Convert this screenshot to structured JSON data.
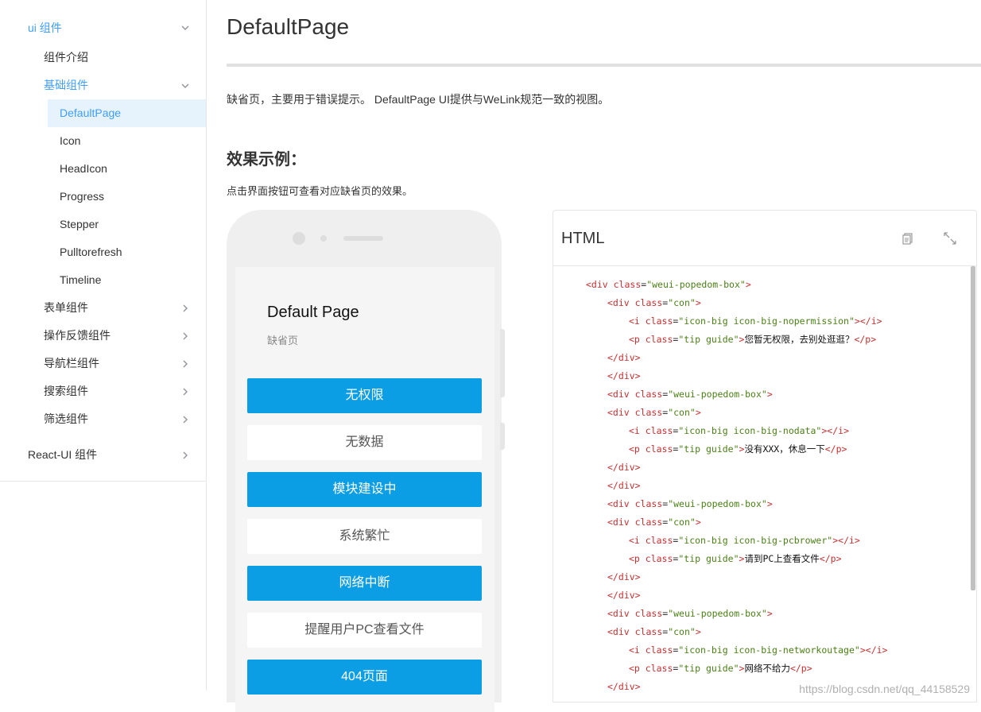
{
  "sidebar": {
    "ui_group": "ui 组件",
    "intro": "组件介绍",
    "basic_group": "基础组件",
    "basic_items": [
      "DefaultPage",
      "Icon",
      "HeadIcon",
      "Progress",
      "Stepper",
      "Pulltorefresh",
      "Timeline"
    ],
    "other_groups": [
      "表单组件",
      "操作反馈组件",
      "导航栏组件",
      "搜索组件",
      "筛选组件"
    ],
    "react_group": "React-UI 组件"
  },
  "main": {
    "title": "DefaultPage",
    "description": "缺省页，主要用于错误提示。 DefaultPage UI提供与WeLink规范一致的视图。",
    "section_title": "效果示例：",
    "hint": "点击界面按钮可查看对应缺省页的效果。"
  },
  "phone": {
    "title": "Default Page",
    "subtitle": "缺省页",
    "buttons": [
      "无权限",
      "无数据",
      "模块建设中",
      "系统繁忙",
      "网络中断",
      "提醒用户PC查看文件",
      "404页面"
    ]
  },
  "code": {
    "lang": "HTML",
    "lines": [
      {
        "indent": 0,
        "kind": "open",
        "tag": "div",
        "class": "weui-popedom-box",
        "text": ""
      },
      {
        "indent": 1,
        "kind": "open",
        "tag": "div",
        "class": "con",
        "text": ""
      },
      {
        "indent": 2,
        "kind": "pair",
        "tag": "i",
        "class": "icon-big icon-big-nopermission",
        "text": ""
      },
      {
        "indent": 2,
        "kind": "pair",
        "tag": "p",
        "class": "tip guide",
        "text": "您暂无权限，去别处逛逛？"
      },
      {
        "indent": 1,
        "kind": "close",
        "tag": "div",
        "class": "",
        "text": ""
      },
      {
        "indent": 1,
        "kind": "close",
        "tag": "div",
        "class": "",
        "text": ""
      },
      {
        "indent": 1,
        "kind": "open",
        "tag": "div",
        "class": "weui-popedom-box",
        "text": ""
      },
      {
        "indent": 1,
        "kind": "open",
        "tag": "div",
        "class": "con",
        "text": ""
      },
      {
        "indent": 2,
        "kind": "pair",
        "tag": "i",
        "class": "icon-big icon-big-nodata",
        "text": ""
      },
      {
        "indent": 2,
        "kind": "pair",
        "tag": "p",
        "class": "tip guide",
        "text": "没有XXX，休息一下"
      },
      {
        "indent": 1,
        "kind": "close",
        "tag": "div",
        "class": "",
        "text": ""
      },
      {
        "indent": 1,
        "kind": "close",
        "tag": "div",
        "class": "",
        "text": ""
      },
      {
        "indent": 1,
        "kind": "open",
        "tag": "div",
        "class": "weui-popedom-box",
        "text": ""
      },
      {
        "indent": 1,
        "kind": "open",
        "tag": "div",
        "class": "con",
        "text": ""
      },
      {
        "indent": 2,
        "kind": "pair",
        "tag": "i",
        "class": "icon-big icon-big-pcbrower",
        "text": ""
      },
      {
        "indent": 2,
        "kind": "pair",
        "tag": "p",
        "class": "tip guide",
        "text": "请到PC上查看文件"
      },
      {
        "indent": 1,
        "kind": "close",
        "tag": "div",
        "class": "",
        "text": ""
      },
      {
        "indent": 1,
        "kind": "close",
        "tag": "div",
        "class": "",
        "text": ""
      },
      {
        "indent": 1,
        "kind": "open",
        "tag": "div",
        "class": "weui-popedom-box",
        "text": ""
      },
      {
        "indent": 1,
        "kind": "open",
        "tag": "div",
        "class": "con",
        "text": ""
      },
      {
        "indent": 2,
        "kind": "pair",
        "tag": "i",
        "class": "icon-big icon-big-networkoutage",
        "text": ""
      },
      {
        "indent": 2,
        "kind": "pair",
        "tag": "p",
        "class": "tip guide",
        "text": "网络不给力"
      },
      {
        "indent": 1,
        "kind": "close",
        "tag": "div",
        "class": "",
        "text": ""
      }
    ]
  },
  "watermark": "https://blog.csdn.net/qq_44158529",
  "icons": {
    "copy": "copy-icon",
    "expand": "expand-icon",
    "chevron": "chevron-icon"
  },
  "colors": {
    "accent": "#409eff",
    "button_blue": "#0b9ee5",
    "active_bg": "#e6f3fd"
  }
}
